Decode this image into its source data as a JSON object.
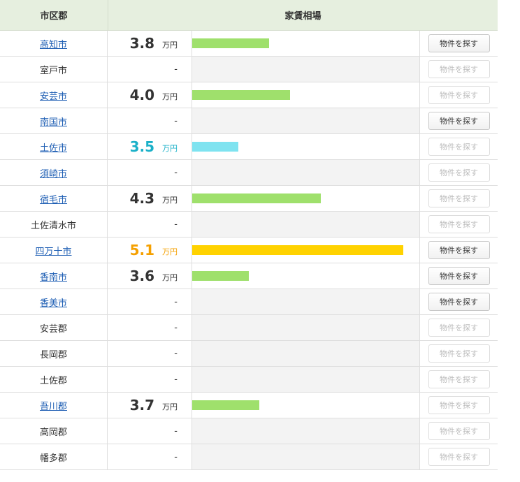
{
  "header": {
    "col_area": "市区郡",
    "col_rent": "家賃相場"
  },
  "button_label": "物件を探す",
  "unit": "万円",
  "colors": {
    "green": "#9fe06c",
    "cyan": "#7fe3f0",
    "gold": "#ffd200",
    "cyan_text": "#1ab0c8",
    "gold_text": "#f5a000"
  },
  "rows": [
    {
      "name": "高知市",
      "link": true,
      "value": 3.8,
      "display": "3.8",
      "highlight": "none",
      "button_enabled": true
    },
    {
      "name": "室戸市",
      "link": false,
      "value": null,
      "display": "-",
      "highlight": "none",
      "button_enabled": false
    },
    {
      "name": "安芸市",
      "link": true,
      "value": 4.0,
      "display": "4.0",
      "highlight": "none",
      "button_enabled": false
    },
    {
      "name": "南国市",
      "link": true,
      "value": null,
      "display": "-",
      "highlight": "none",
      "button_enabled": true
    },
    {
      "name": "土佐市",
      "link": true,
      "value": 3.5,
      "display": "3.5",
      "highlight": "low",
      "button_enabled": false
    },
    {
      "name": "須崎市",
      "link": true,
      "value": null,
      "display": "-",
      "highlight": "none",
      "button_enabled": false
    },
    {
      "name": "宿毛市",
      "link": true,
      "value": 4.3,
      "display": "4.3",
      "highlight": "none",
      "button_enabled": false
    },
    {
      "name": "土佐清水市",
      "link": false,
      "value": null,
      "display": "-",
      "highlight": "none",
      "button_enabled": false
    },
    {
      "name": "四万十市",
      "link": true,
      "value": 5.1,
      "display": "5.1",
      "highlight": "high",
      "button_enabled": true
    },
    {
      "name": "香南市",
      "link": true,
      "value": 3.6,
      "display": "3.6",
      "highlight": "none",
      "button_enabled": true
    },
    {
      "name": "香美市",
      "link": true,
      "value": null,
      "display": "-",
      "highlight": "none",
      "button_enabled": true
    },
    {
      "name": "安芸郡",
      "link": false,
      "value": null,
      "display": "-",
      "highlight": "none",
      "button_enabled": false
    },
    {
      "name": "長岡郡",
      "link": false,
      "value": null,
      "display": "-",
      "highlight": "none",
      "button_enabled": false
    },
    {
      "name": "土佐郡",
      "link": false,
      "value": null,
      "display": "-",
      "highlight": "none",
      "button_enabled": false
    },
    {
      "name": "吾川郡",
      "link": true,
      "value": 3.7,
      "display": "3.7",
      "highlight": "none",
      "button_enabled": false
    },
    {
      "name": "高岡郡",
      "link": false,
      "value": null,
      "display": "-",
      "highlight": "none",
      "button_enabled": false
    },
    {
      "name": "幡多郡",
      "link": false,
      "value": null,
      "display": "-",
      "highlight": "none",
      "button_enabled": false
    }
  ]
}
